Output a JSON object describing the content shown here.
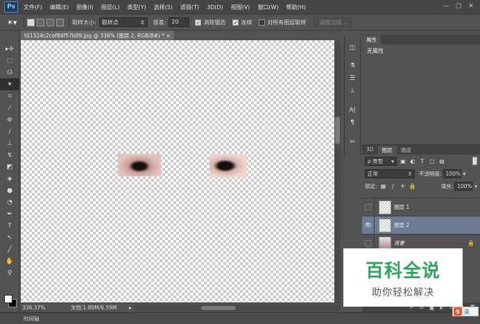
{
  "app": {
    "logo": "Ps",
    "menu": [
      "文件(F)",
      "编辑(E)",
      "图像(I)",
      "图层(L)",
      "类型(Y)",
      "选择(S)",
      "滤镜(T)",
      "3D(D)",
      "视图(V)",
      "窗口(W)",
      "帮助(H)"
    ],
    "window_controls": [
      "—",
      "□",
      "✕"
    ]
  },
  "options": {
    "tool_icon": "magic-wand-icon",
    "sample_size_label": "取样大小:",
    "sample_size_value": "取样点",
    "tolerance_label": "容差:",
    "tolerance_value": "20",
    "antialias_label": "消除锯齿",
    "contiguous_label": "连续",
    "all_layers_label": "对所有图层取样",
    "refine_edge_label": "调整边缘..."
  },
  "document": {
    "tab_title": "t01324c2cef84f57b09.jpg @ 336% (图层 2, RGB/8#) * ×"
  },
  "status": {
    "zoom": "336.37%",
    "doc_info": "文档:1.80M/6.59M"
  },
  "timeline": {
    "label": "时间轴"
  },
  "properties": {
    "tab": "属性",
    "content": "无属性"
  },
  "layers": {
    "tabs": [
      "3D",
      "图层",
      "通道"
    ],
    "filter_kind": "ρ 类型",
    "blend_mode": "正常",
    "opacity_label": "不透明度:",
    "opacity_value": "100%",
    "lock_label": "锁定:",
    "fill_label": "填充:",
    "fill_value": "100%",
    "items": [
      {
        "name": "图层 1",
        "visible": false,
        "selected": false
      },
      {
        "name": "图层 2",
        "visible": true,
        "selected": true
      },
      {
        "name": "背景",
        "visible": false,
        "selected": false
      }
    ],
    "footer_icons": [
      "∞",
      "fx",
      "◙",
      "◐",
      "▭",
      "▣",
      "🗑"
    ]
  },
  "watermark": {
    "title": "百科全说",
    "subtitle": "助你轻松解决"
  },
  "ime": {
    "badge": "S",
    "lang": "英"
  }
}
